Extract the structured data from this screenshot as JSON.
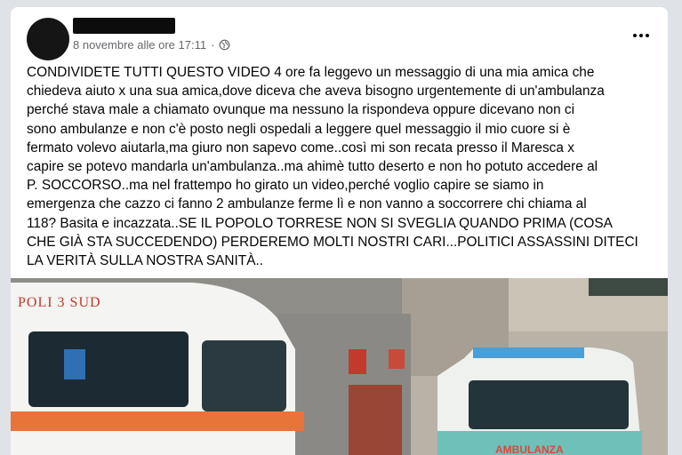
{
  "post": {
    "author_redacted": true,
    "timestamp": "8 novembre alle ore 17:11",
    "separator": "·",
    "privacy_icon": "globe-icon",
    "menu_icon": "more-options-icon",
    "text": "CONDIVIDETE TUTTI QUESTO VIDEO 4 ore fa leggevo un messaggio di una mia amica che\nchiedeva aiuto x una sua amica,dove diceva che aveva bisogno urgentemente di un'ambulanza\nperché stava male a chiamato ovunque ma nessuno la rispondeva oppure dicevano non ci\nsono ambulanze e non c'è posto negli ospedali a leggere quel messaggio il mio cuore si è\nfermato volevo aiutarla,ma giuro non sapevo come..così mi son recata presso il Maresca x\ncapire se potevo mandarla un'ambulanza..ma ahimè tutto deserto e non ho potuto accedere al\nP. SOCCORSO..ma nel frattempo ho girato un video,perché voglio capire se siamo in\nemergenza che cazzo ci fanno 2 ambulanze ferme lì e non vanno a soccorrere chi chiama al\n118? Basita e incazzata..SE IL POPOLO TORRESE NON SI SVEGLIA QUANDO PRIMA (COSA\nCHE GIÀ STA SUCCEDENDO) PERDEREMO MOLTI NOSTRI CARI...POLITICI ASSASSINI DITECI\nLA VERITÀ SULLA NOSTRA SANITÀ..",
    "image": {
      "ambulance_left_text": "POLI 3 SUD",
      "ambulance_right_text": "AMBULANZA"
    }
  },
  "colors": {
    "page_bg": "#dfe2e7",
    "card_bg": "#ffffff",
    "meta_text": "#65676b",
    "body_text": "#050505",
    "ambulance_orange": "#e8743a",
    "ambulance_teal": "#6fc0b8"
  }
}
